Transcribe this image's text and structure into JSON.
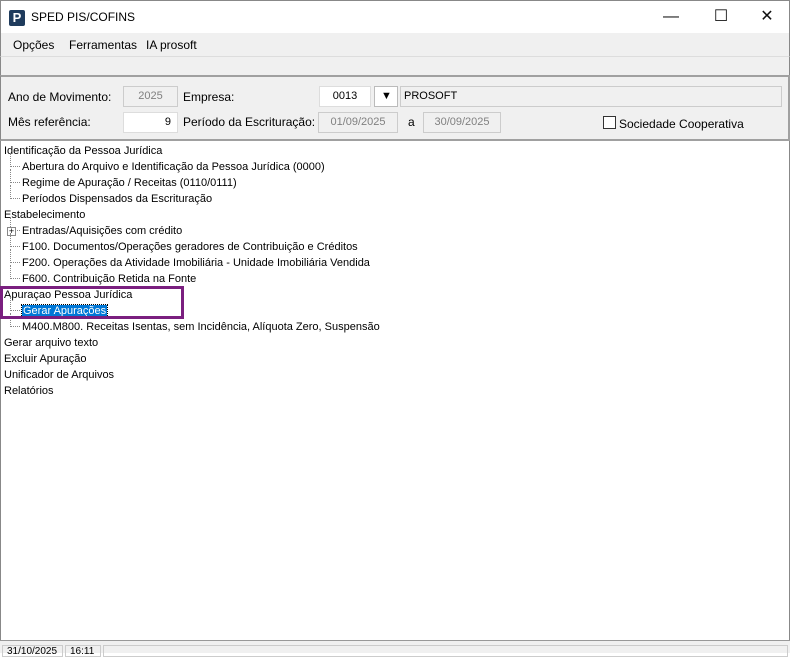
{
  "window": {
    "title": "SPED PIS/COFINS",
    "app_icon": "P",
    "minimize": "—",
    "maximize": "☐",
    "close": "✕"
  },
  "menu": [
    "Opções",
    "Ferramentas",
    "IA prosoft"
  ],
  "form": {
    "ano_label": "Ano de Movimento:",
    "ano_value": "2025",
    "empresa_label": "Empresa:",
    "empresa_code": "0013",
    "empresa_name": "PROSOFT",
    "mes_label": "Mês referência:",
    "mes_value": "9",
    "periodo_label": "Período da Escrituração:",
    "periodo_inicio": "01/09/2025",
    "periodo_sep": "a",
    "periodo_fim": "30/09/2025",
    "cooperativa_label": "Sociedade Cooperativa"
  },
  "tree": [
    {
      "label": "Identificação da Pessoa Jurídica",
      "level": 0
    },
    {
      "label": "Abertura do Arquivo e Identificação da Pessoa Jurídica (0000)",
      "level": 1
    },
    {
      "label": "Regime de Apuração / Receitas (0110/0111)",
      "level": 1
    },
    {
      "label": "Períodos Dispensados da Escrituração",
      "level": 1
    },
    {
      "label": "Estabelecimento",
      "level": 0
    },
    {
      "label": "Entradas/Aquisições com crédito",
      "level": 1,
      "expandable": true
    },
    {
      "label": "F100. Documentos/Operações geradores de Contribuição e Créditos",
      "level": 1
    },
    {
      "label": "F200. Operações da Atividade Imobiliária - Unidade Imobiliária Vendida",
      "level": 1
    },
    {
      "label": "F600. Contribuição Retida na Fonte",
      "level": 1
    },
    {
      "label": "Apuraçao Pessoa Jurídica",
      "level": 0
    },
    {
      "label": "Gerar Apurações",
      "level": 1,
      "selected": true
    },
    {
      "label": "M400.M800. Receitas Isentas, sem Incidência, Alíquota Zero, Suspensão",
      "level": 1
    },
    {
      "label": "Gerar arquivo texto",
      "level": 0
    },
    {
      "label": "Excluir Apuração",
      "level": 0
    },
    {
      "label": "Unificador de Arquivos",
      "level": 0
    },
    {
      "label": "Relatórios",
      "level": 0
    }
  ],
  "status": {
    "date": "31/10/2025",
    "time": "16:11"
  }
}
